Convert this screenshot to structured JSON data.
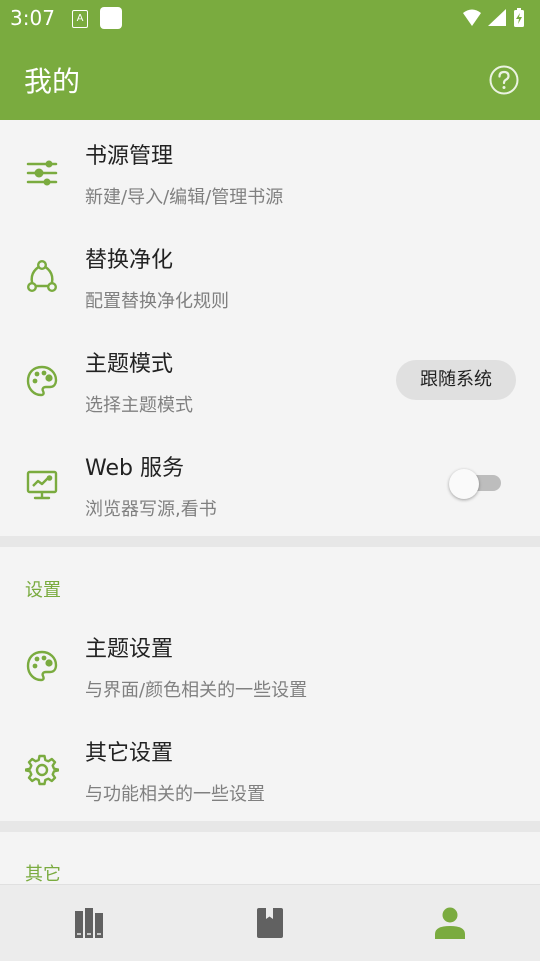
{
  "status_bar": {
    "time": "3:07",
    "notification_glyph": "A",
    "icons": [
      "wifi-icon",
      "signal-icon",
      "battery-icon"
    ]
  },
  "app_bar": {
    "title": "我的",
    "help_icon": "help-circle-icon"
  },
  "main_items": [
    {
      "title": "书源管理",
      "subtitle": "新建/导入/编辑/管理书源",
      "icon": "sliders-icon"
    },
    {
      "title": "替换净化",
      "subtitle": "配置替换净化规则",
      "icon": "nodes-icon"
    },
    {
      "title": "主题模式",
      "subtitle": "选择主题模式",
      "icon": "palette-icon",
      "control_label": "跟随系统"
    },
    {
      "title": "Web 服务",
      "subtitle": "浏览器写源,看书",
      "icon": "monitor-chart-icon",
      "switch_on": false
    }
  ],
  "settings_section": {
    "label": "设置",
    "items": [
      {
        "title": "主题设置",
        "subtitle": "与界面/颜色相关的一些设置",
        "icon": "palette-icon"
      },
      {
        "title": "其它设置",
        "subtitle": "与功能相关的一些设置",
        "icon": "gear-icon"
      }
    ]
  },
  "other_section": {
    "label": "其它"
  },
  "bottom_nav": {
    "items": [
      {
        "name": "bookshelf",
        "icon": "bookshelf-icon",
        "active": false
      },
      {
        "name": "explore",
        "icon": "book-icon",
        "active": false
      },
      {
        "name": "my",
        "icon": "person-icon",
        "active": true
      }
    ]
  },
  "colors": {
    "primary": "#7aab3f",
    "background": "#f4f4f4",
    "separator": "#e7e7e7",
    "text_primary": "#222222",
    "text_secondary": "#808080",
    "nav_inactive": "#616161"
  }
}
